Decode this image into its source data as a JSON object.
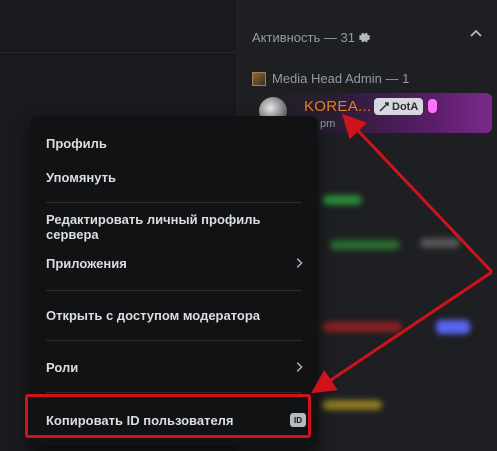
{
  "member_list": {
    "activity_header": "Активность — 31",
    "role_header": "Media Head Admin — 1",
    "member": {
      "name": "KOREA...",
      "game_tag": "DotA",
      "status": "pm"
    }
  },
  "context_menu": {
    "items": [
      {
        "label": "Профиль"
      },
      {
        "label": "Упомянуть"
      },
      {
        "label": "Редактировать личный профиль сервера"
      },
      {
        "label": "Приложения"
      },
      {
        "label": "Открыть с доступом модератора"
      },
      {
        "label": "Роли"
      },
      {
        "label": "Копировать ID пользователя",
        "badge": "ID"
      }
    ]
  },
  "colors": {
    "annotation_red": "#d0121b",
    "member_name": "#e67e22",
    "menu_background": "#111214"
  },
  "icons": [
    "gear-icon",
    "chevron-up-icon",
    "chevron-right-icon",
    "id-icon",
    "sword-icon",
    "boost-icon",
    "role-badge-icon"
  ]
}
